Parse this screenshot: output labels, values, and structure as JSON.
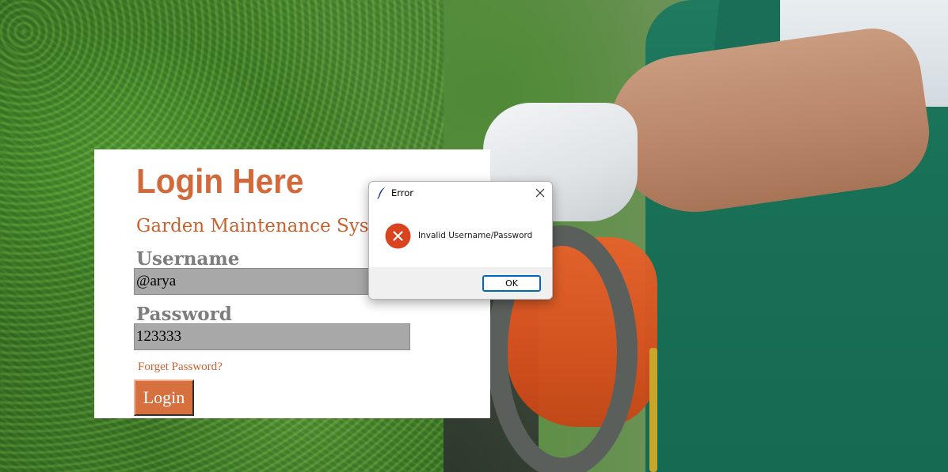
{
  "login": {
    "title": "Login Here",
    "subtitle": "Garden Maintenance Syste",
    "username_label": "Username",
    "username_value": "@arya",
    "password_label": "Password",
    "password_value": "123333",
    "forget_link": "Forget Password?",
    "login_button": "Login"
  },
  "dialog": {
    "title": "Error",
    "message": "Invalid Username/Password",
    "ok_button": "OK",
    "icon": "error-icon",
    "title_icon": "feather-icon",
    "close_icon": "close-icon"
  },
  "colors": {
    "accent": "#d2693a",
    "button_bg": "#d7703f",
    "field_bg": "#a8a8a8",
    "error_red": "#d9431f",
    "dialog_focus": "#0067c0"
  }
}
